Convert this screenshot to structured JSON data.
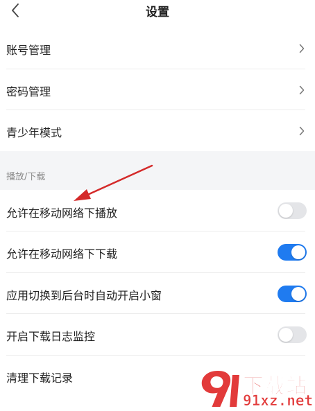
{
  "header": {
    "title": "设置"
  },
  "account_section": {
    "items": [
      {
        "label": "账号管理"
      },
      {
        "label": "密码管理"
      },
      {
        "label": "青少年模式"
      }
    ]
  },
  "playback_section": {
    "title": "播放/下载",
    "items": [
      {
        "label": "允许在移动网络下播放",
        "enabled": false
      },
      {
        "label": "允许在移动网络下下载",
        "enabled": true
      },
      {
        "label": "应用切换到后台时自动开启小窗",
        "enabled": true
      },
      {
        "label": "开启下载日志监控",
        "enabled": false
      },
      {
        "label": "清理下载记录"
      }
    ]
  },
  "watermark": {
    "brand_text": "下载站",
    "domain_text": "91xz.net"
  },
  "colors": {
    "accent": "#1f7bf0",
    "toggle_off": "#e4e5e8",
    "section_bg": "#f4f5f7",
    "annotation": "#d42a2a"
  }
}
